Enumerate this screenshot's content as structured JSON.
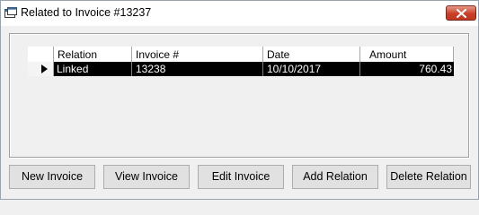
{
  "window": {
    "title": "Related to Invoice #13237",
    "close_icon": "close-icon"
  },
  "grid": {
    "columns": [
      "Relation",
      "Invoice #",
      "Date",
      "Amount"
    ],
    "rows": [
      {
        "selected": true,
        "relation": "Linked",
        "invoice": "13238",
        "date": "10/10/2017",
        "amount": "760.43"
      }
    ]
  },
  "buttons": {
    "new_invoice": "New Invoice",
    "view_invoice": "View Invoice",
    "edit_invoice": "Edit Invoice",
    "add_relation": "Add Relation",
    "delete_relation": "Delete Relation"
  },
  "colors": {
    "selected_row_bg": "#000000",
    "selected_row_text": "#ffffff",
    "close_button": "#c9402a"
  }
}
